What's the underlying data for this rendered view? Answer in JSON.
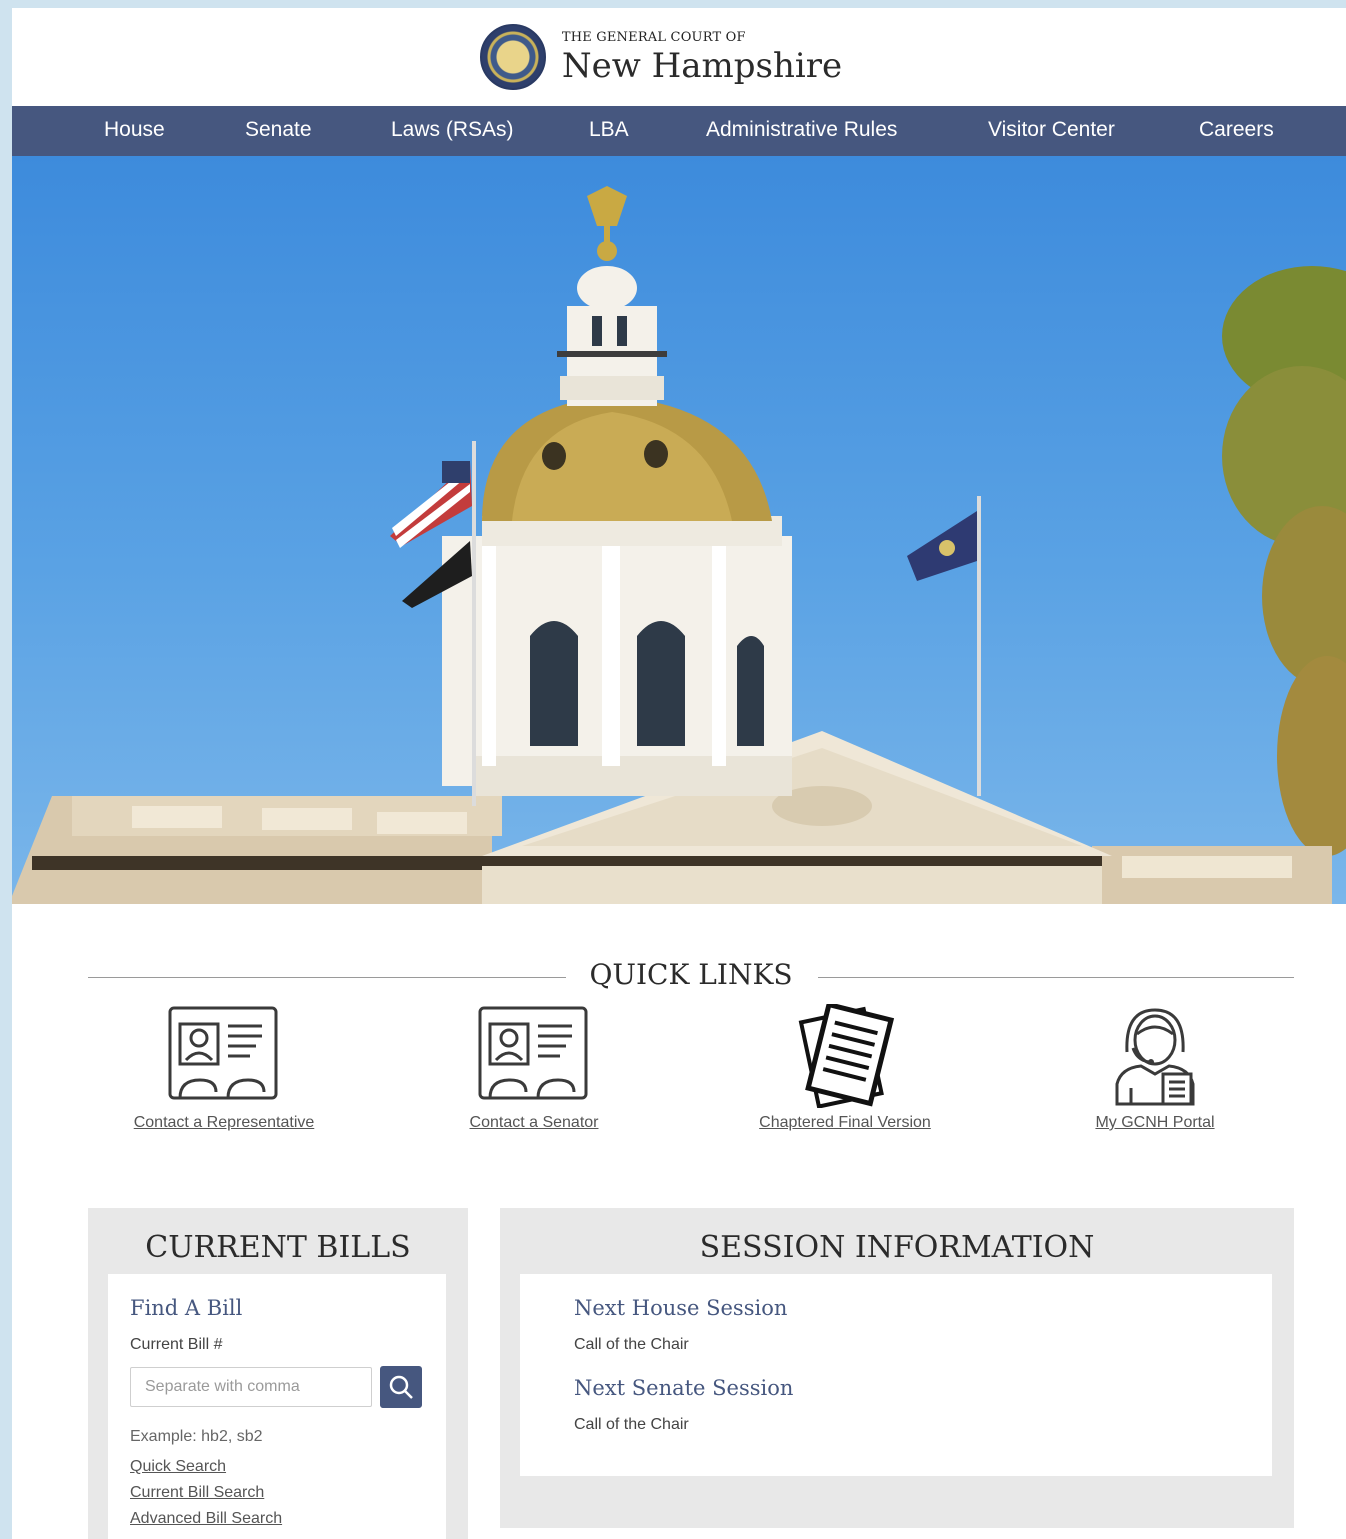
{
  "header": {
    "small_title": "THE GENERAL COURT OF",
    "big_title": "New Hampshire"
  },
  "nav": {
    "items": [
      {
        "label": "House"
      },
      {
        "label": "Senate"
      },
      {
        "label": "Laws (RSAs)"
      },
      {
        "label": "LBA"
      },
      {
        "label": "Administrative Rules"
      },
      {
        "label": "Visitor Center"
      },
      {
        "label": "Careers"
      }
    ]
  },
  "quick_links": {
    "title": "QUICK LINKS",
    "items": [
      {
        "label": "Contact a Representative",
        "icon": "contact-card-icon"
      },
      {
        "label": "Contact a Senator",
        "icon": "contact-card-icon"
      },
      {
        "label": "Chaptered Final Version",
        "icon": "documents-icon"
      },
      {
        "label": "My GCNH Portal",
        "icon": "support-agent-icon"
      }
    ]
  },
  "current_bills": {
    "title": "CURRENT BILLS",
    "find_heading": "Find A Bill",
    "field_label": "Current Bill #",
    "placeholder": "Separate with comma",
    "example": "Example: hb2, sb2",
    "links": [
      "Quick Search",
      "Current Bill Search",
      "Advanced Bill Search"
    ]
  },
  "session_info": {
    "title": "SESSION INFORMATION",
    "house_heading": "Next House Session",
    "house_value": "Call of the Chair",
    "senate_heading": "Next Senate Session",
    "senate_value": "Call of the Chair"
  },
  "colors": {
    "nav_bg": "#46577f",
    "panel_bg": "#e8e8e8",
    "accent": "#46577f"
  }
}
